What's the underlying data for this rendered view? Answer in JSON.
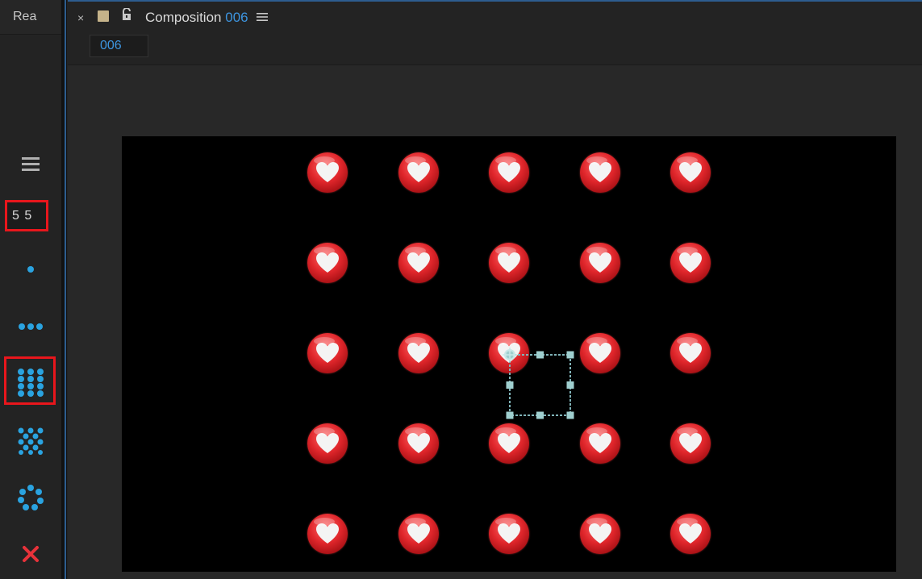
{
  "left_panel": {
    "tab_label": "Rea",
    "grid_value": "5 5",
    "presets": [
      "hamburger-icon",
      "single-dot-icon",
      "three-dots-icon",
      "grid-3x3-icon",
      "diamond-dots-icon",
      "circle-dots-icon",
      "close-icon"
    ]
  },
  "composition": {
    "close_glyph": "×",
    "title": "Composition",
    "title_number": "006",
    "tab": "006",
    "colors": {
      "accent": "#3d95e0",
      "swatch": "#c5b38a",
      "highlight": "#e8161c",
      "close": "#e8323a"
    }
  },
  "canvas": {
    "grid": {
      "rows": 5,
      "columns": 5
    }
  }
}
